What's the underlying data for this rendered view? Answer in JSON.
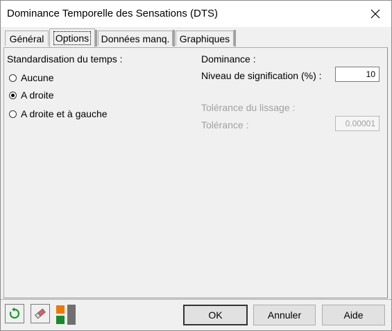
{
  "window": {
    "title": "Dominance Temporelle des Sensations (DTS)"
  },
  "tabs": [
    {
      "label": "Général"
    },
    {
      "label": "Options"
    },
    {
      "label": "Données manq."
    },
    {
      "label": "Graphiques"
    }
  ],
  "active_tab": "Options",
  "standardisation": {
    "heading": "Standardisation du temps :",
    "options": [
      {
        "label": "Aucune",
        "checked": false
      },
      {
        "label": "A droite",
        "checked": true
      },
      {
        "label": "A droite et à gauche",
        "checked": false
      }
    ]
  },
  "dominance": {
    "heading": "Dominance :",
    "significance_label": "Niveau de signification (%) :",
    "significance_value": "10"
  },
  "smoothing": {
    "heading": "Tolérance du lissage :",
    "tolerance_label": "Tolérance :",
    "tolerance_value": "0.00001"
  },
  "buttons": {
    "ok": "OK",
    "cancel": "Annuler",
    "help": "Aide"
  },
  "toolbar_icons": [
    "reset-icon",
    "eraser-icon",
    "layout-toggle-icon"
  ]
}
